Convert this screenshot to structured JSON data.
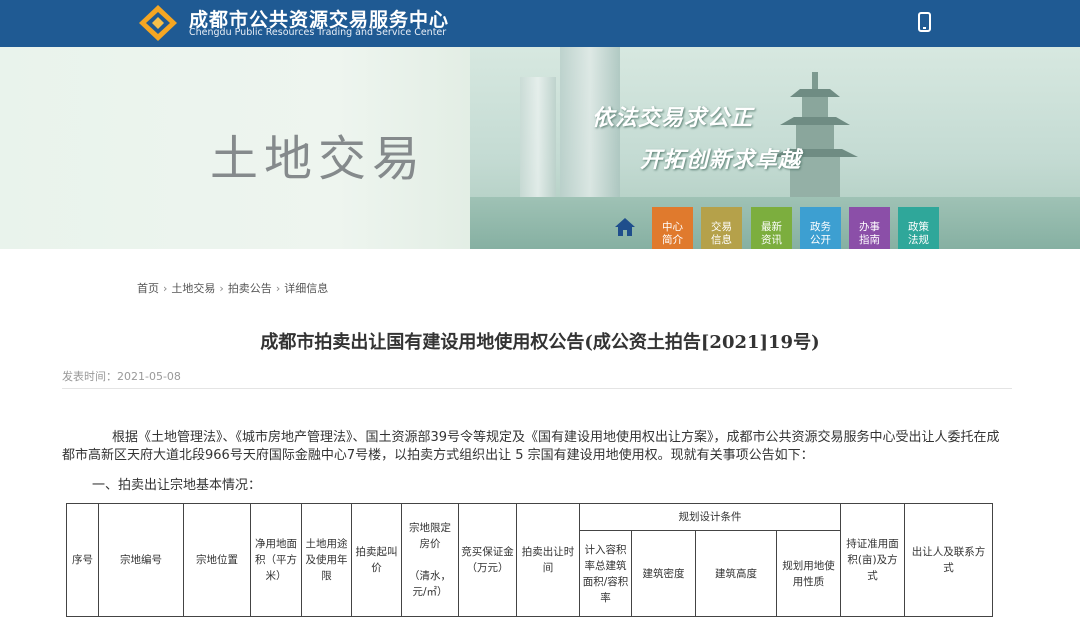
{
  "header": {
    "site_name": "成都市公共资源交易服务中心",
    "site_name_en": "Chengdu Public Resources Trading and Service Center",
    "logo_icon": "diamond-logo-icon",
    "mobile_icon": "mobile-phone-icon",
    "bg_color": "#1f5a93"
  },
  "banner": {
    "title": "土地交易",
    "slogan_1": "依法交易求公正",
    "slogan_2": "开拓创新求卓越",
    "home_icon": "home-icon",
    "nav": [
      {
        "line1": "中心",
        "line2": "简介",
        "color": "#e07a2d"
      },
      {
        "line1": "交易",
        "line2": "信息",
        "color": "#b5a14a"
      },
      {
        "line1": "最新",
        "line2": "资讯",
        "color": "#7cae3e"
      },
      {
        "line1": "政务",
        "line2": "公开",
        "color": "#3d9fd1"
      },
      {
        "line1": "办事",
        "line2": "指南",
        "color": "#8b4fa8"
      },
      {
        "line1": "政策",
        "line2": "法规",
        "color": "#2fa79a"
      }
    ]
  },
  "breadcrumb": [
    "首页",
    "土地交易",
    "拍卖公告",
    "详细信息"
  ],
  "article": {
    "title": "成都市拍卖出让国有建设用地使用权公告(成公资土拍告[2021]19号)",
    "pub_time_label": "发表时间：",
    "pub_time": "2021-05-08",
    "paragraph_1": "根据《土地管理法》、《城市房地产管理法》、国土资源部39号令等规定及《国有建设用地使用权出让方案》，成都市公共资源交易服务中心受出让人委托在成都市高新区天府大道北段966号天府国际金融中心7号楼，以拍卖方式组织出让 5 宗国有建设用地使用权。现就有关事项公告如下：",
    "section_1": "一、拍卖出让宗地基本情况："
  },
  "table": {
    "group_header": "规划设计条件",
    "headers": {
      "seq": "序号",
      "parcel_no": "宗地编号",
      "location": "宗地位置",
      "net_area": "净用地面积（平方米）",
      "land_use": "土地用途及使用年限",
      "start_price": "拍卖起叫价",
      "house_price_cap": "宗地限定房价",
      "house_price_unit": "（清水，元/㎡）",
      "deposit": "竞买保证金（万元）",
      "auction_time": "拍卖出让时间",
      "far": "计入容积率总建筑面积/容积率",
      "density": "建筑密度",
      "height": "建筑高度",
      "plan_use": "规划用地使用性质",
      "cert_area": "持证准用面积(亩)及方式",
      "contact": "出让人及联系方式"
    }
  }
}
